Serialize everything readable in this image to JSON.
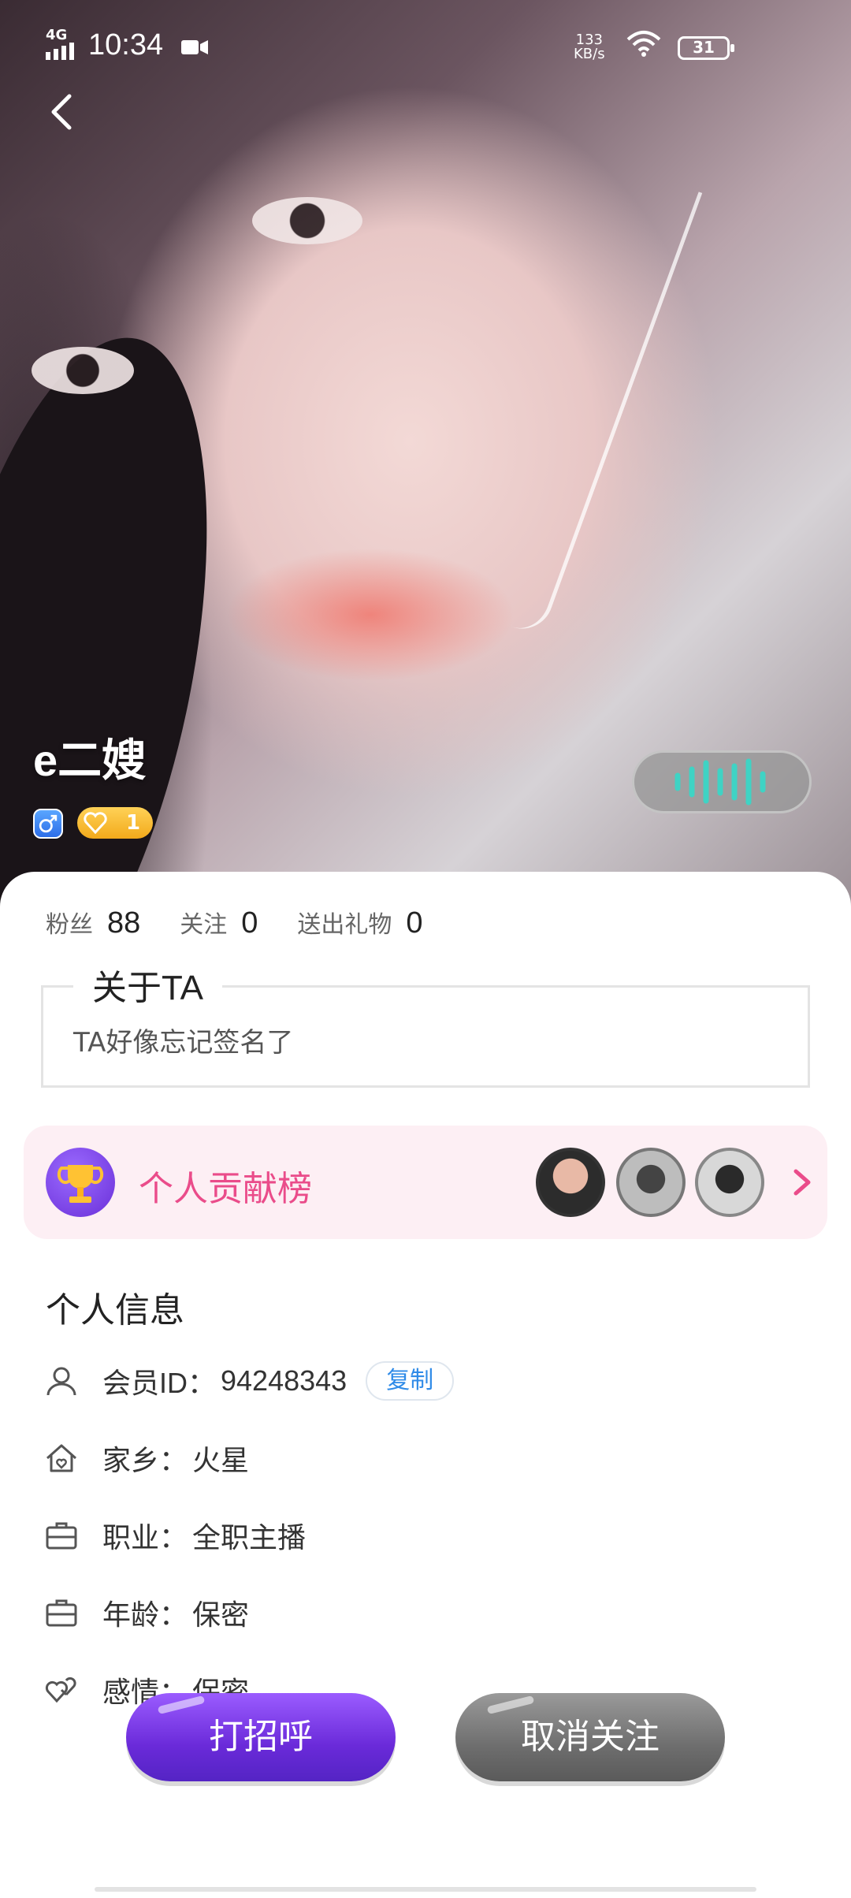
{
  "status_bar": {
    "network": "4G",
    "time": "10:34",
    "speed_value": "133",
    "speed_unit": "KB/s",
    "battery": "31"
  },
  "profile": {
    "nickname": "e二嫂",
    "gender_icon": "male-symbol-icon",
    "level": "1"
  },
  "stats": {
    "fans_label": "粉丝",
    "fans_value": "88",
    "follow_label": "关注",
    "follow_value": "0",
    "gifts_label": "送出礼物",
    "gifts_value": "0"
  },
  "about": {
    "title": "关于TA",
    "text": "TA好像忘记签名了"
  },
  "rank": {
    "label": "个人贡献榜"
  },
  "info": {
    "title": "个人信息",
    "member_id_label": "会员ID：",
    "member_id_value": "94248343",
    "copy_label": "复制",
    "hometown_label": "家乡：",
    "hometown_value": "火星",
    "job_label": "职业：",
    "job_value": "全职主播",
    "age_label": "年龄：",
    "age_value": "保密",
    "relationship_label": "感情：",
    "relationship_value": "保密"
  },
  "actions": {
    "greet": "打招呼",
    "unfollow": "取消关注"
  },
  "colors": {
    "accent_pink": "#ea4c8a",
    "accent_purple": "#6a2ad9",
    "link_blue": "#2f8be8"
  }
}
